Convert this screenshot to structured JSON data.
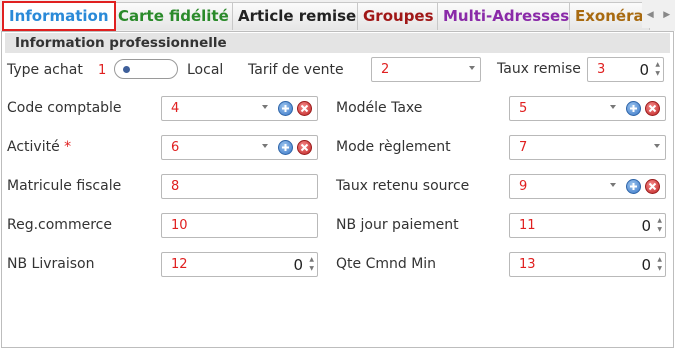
{
  "tabs": [
    {
      "label": "Information",
      "color": "#2a8ad8"
    },
    {
      "label": "Carte fidélité",
      "color": "#2a8a2a"
    },
    {
      "label": "Article remise",
      "color": "#222222"
    },
    {
      "label": "Groupes",
      "color": "#a01818"
    },
    {
      "label": "Multi-Adresses",
      "color": "#8a2aa8"
    },
    {
      "label": "Exonéra",
      "color": "#a86a10"
    }
  ],
  "tab_scroll": {
    "left": "◀",
    "right": "▶"
  },
  "section": {
    "title": "Information professionnelle"
  },
  "type_achat": {
    "label": "Type achat",
    "num": "1",
    "toggle_value": "Local"
  },
  "tarif_vente": {
    "label": "Tarif de vente",
    "num": "2"
  },
  "taux_remise": {
    "label": "Taux remise",
    "num": "3",
    "value": "0"
  },
  "code_comptable": {
    "label": "Code comptable",
    "num": "4"
  },
  "modele_taxe": {
    "label": "Modéle Taxe",
    "num": "5"
  },
  "activite": {
    "label": "Activité",
    "required": "*",
    "num": "6"
  },
  "mode_reglement": {
    "label": "Mode règlement",
    "num": "7"
  },
  "matricule_fiscale": {
    "label": "Matricule fiscale",
    "num": "8"
  },
  "taux_retenu": {
    "label": "Taux retenu source",
    "num": "9"
  },
  "reg_commerce": {
    "label": "Reg.commerce",
    "num": "10"
  },
  "nb_jour_paiement": {
    "label": "NB jour paiement",
    "num": "11",
    "value": "0"
  },
  "nb_livraison": {
    "label": "NB Livraison",
    "num": "12",
    "value": "0"
  },
  "qte_cmnd_min": {
    "label": "Qte Cmnd Min",
    "num": "13",
    "value": "0"
  }
}
